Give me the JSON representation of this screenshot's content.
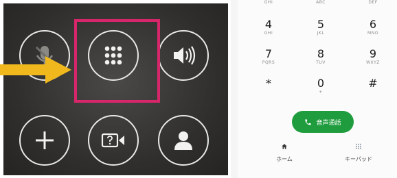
{
  "phone": {
    "top_row_letters": [
      "GHI",
      "ABC",
      "DEF"
    ],
    "keys": [
      {
        "digit": "4",
        "letters": "GHI"
      },
      {
        "digit": "5",
        "letters": "JKL"
      },
      {
        "digit": "6",
        "letters": "MNO"
      },
      {
        "digit": "7",
        "letters": "PQRS"
      },
      {
        "digit": "8",
        "letters": "TUV"
      },
      {
        "digit": "9",
        "letters": "WXYZ"
      },
      {
        "digit": "*",
        "letters": ""
      },
      {
        "digit": "0",
        "letters": "+"
      },
      {
        "digit": "#",
        "letters": ""
      }
    ],
    "call_button_label": "音声通話",
    "nav": {
      "home_label": "ホーム",
      "keypad_label": "キーパッド"
    },
    "colors": {
      "call_green": "#1f9d3e",
      "highlight_pink": "#d8266a",
      "arrow_yellow": "#f0b81c"
    }
  }
}
